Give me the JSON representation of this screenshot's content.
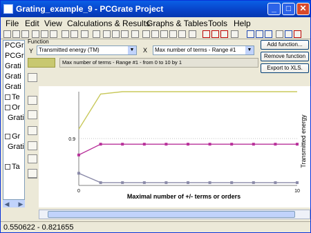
{
  "window": {
    "title": "Grating_example_9 - PCGrate Project",
    "min_glyph": "_",
    "max_glyph": "□",
    "close_glyph": "✕"
  },
  "menu": [
    "File",
    "Edit",
    "View",
    "Calculations & Results",
    "Graphs & Tables",
    "Tools",
    "Help"
  ],
  "tree": {
    "items": [
      "PCGra",
      "PCGra",
      "Grati",
      "Grati",
      "Grati",
      "Te",
      "Or",
      "Grati",
      "Gr",
      "Grati",
      "Ta"
    ]
  },
  "function_panel": {
    "group_label": "Function",
    "y_label": "Y",
    "y_select": "Transmitted energy (TM)",
    "x_separator": "X",
    "x_select": "Max number of terms - Range #1",
    "range_text": "Max number of terms - Range #1 - from 0 to 10 by 1",
    "swatch_color": "#c8c870"
  },
  "side_buttons": {
    "add": "Add function...",
    "remove": "Remove function",
    "export": "Export to XLS."
  },
  "chart_data": {
    "type": "line",
    "xlabel": "Maximal number of  +/- terms or orders",
    "ylabel": "Transmitted energy",
    "x": [
      0,
      1,
      2,
      3,
      4,
      5,
      6,
      7,
      8,
      9,
      10
    ],
    "x_ticks": [
      "0",
      "10"
    ],
    "y_ticks": [
      "0.9"
    ],
    "xlim": [
      0,
      10
    ],
    "ylim": [
      0.8,
      1.0
    ],
    "grid": false,
    "series": [
      {
        "color": "#c8c85a",
        "marker": "none",
        "values": [
          0.92,
          0.995,
          1.0,
          1.0,
          1.0,
          1.0,
          1.0,
          1.0,
          1.0,
          1.0,
          1.0
        ]
      },
      {
        "color": "#b8309a",
        "marker": "square",
        "values": [
          0.865,
          0.888,
          0.888,
          0.888,
          0.888,
          0.888,
          0.888,
          0.888,
          0.888,
          0.888,
          0.888
        ]
      },
      {
        "color": "#8a8aa8",
        "marker": "square",
        "values": [
          0.826,
          0.806,
          0.806,
          0.806,
          0.806,
          0.806,
          0.806,
          0.806,
          0.806,
          0.806,
          0.806
        ]
      }
    ]
  },
  "status": {
    "coords": "0.550622 - 0.821655"
  }
}
